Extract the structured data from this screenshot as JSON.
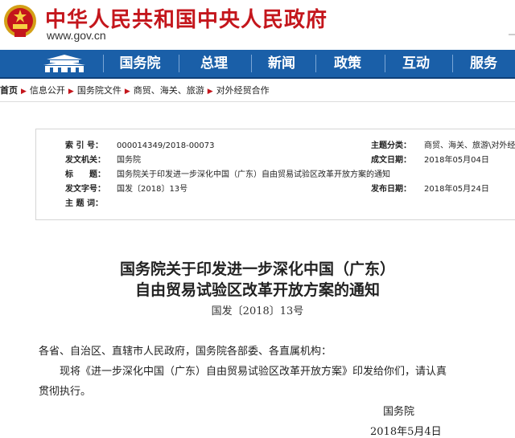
{
  "header": {
    "title": "中华人民共和国中央人民政府",
    "url": "www.gov.cn",
    "emblem_icon": "national-emblem-icon",
    "accent_color": "#c4161c"
  },
  "nav": {
    "color": "#1a5fa8",
    "items": [
      "国务院",
      "总理",
      "新闻",
      "政策",
      "互动",
      "服务"
    ]
  },
  "breadcrumb": [
    "首页",
    "信息公开",
    "国务院文件",
    "商贸、海关、旅游",
    "对外经贸合作"
  ],
  "meta": {
    "index_label": "索 引 号：",
    "index_value": "000014349/2018-00073",
    "category_label": "主题分类：",
    "category_value": "商贸、海关、旅游\\对外经",
    "issuer_label": "发文机关：",
    "issuer_value": "国务院",
    "written_label": "成文日期：",
    "written_value": "2018年05月04日",
    "title_label": "标　　题：",
    "title_value": "国务院关于印发进一步深化中国（广东）自由贸易试验区改革开放方案的通知",
    "docno_label": "发文字号：",
    "docno_value": "国发〔2018〕13号",
    "pub_label": "发布日期：",
    "pub_value": "2018年05月24日",
    "keyword_label": "主 题 词：",
    "keyword_value": ""
  },
  "document": {
    "title_line1": "国务院关于印发进一步深化中国（广东）",
    "title_line2": "自由贸易试验区改革开放方案的通知",
    "doc_number": "国发〔2018〕13号",
    "salutation": "各省、自治区、直辖市人民政府，国务院各部委、各直属机构：",
    "body_line1": "现将《进一步深化中国（广东）自由贸易试验区改革开放方案》印发给你们，请认真",
    "body_line2": "贯彻执行。",
    "signature": "国务院",
    "date": "2018年5月4日"
  }
}
